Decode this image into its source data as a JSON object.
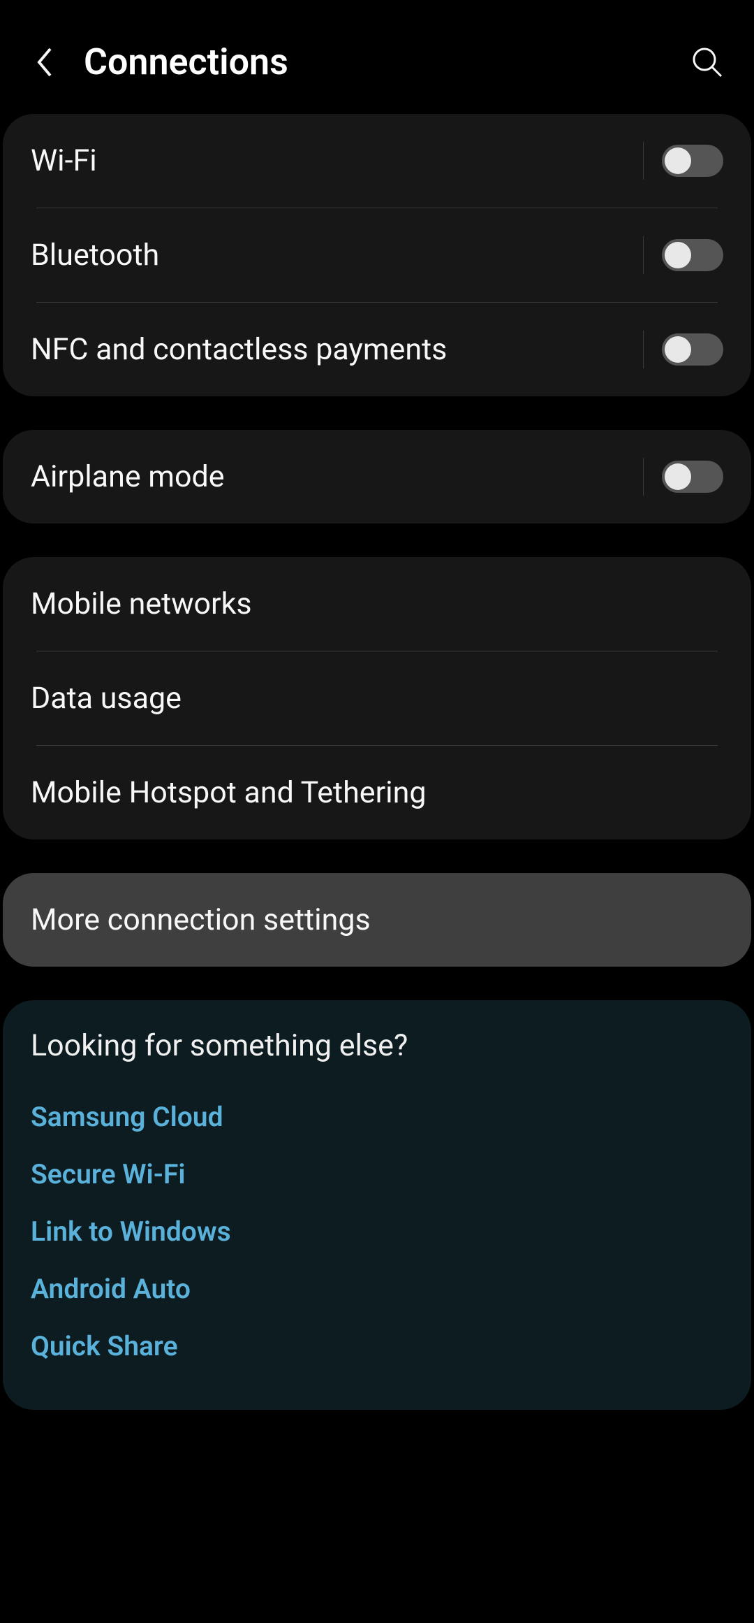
{
  "header": {
    "title": "Connections"
  },
  "group1": {
    "items": [
      {
        "label": "Wi-Fi",
        "toggle": false
      },
      {
        "label": "Bluetooth",
        "toggle": false
      },
      {
        "label": "NFC and contactless payments",
        "toggle": false
      }
    ]
  },
  "group2": {
    "items": [
      {
        "label": "Airplane mode",
        "toggle": false
      }
    ]
  },
  "group3": {
    "items": [
      {
        "label": "Mobile networks"
      },
      {
        "label": "Data usage"
      },
      {
        "label": "Mobile Hotspot and Tethering"
      }
    ]
  },
  "group4": {
    "items": [
      {
        "label": "More connection settings"
      }
    ]
  },
  "looking": {
    "title": "Looking for something else?",
    "links": [
      {
        "label": "Samsung Cloud"
      },
      {
        "label": "Secure Wi-Fi"
      },
      {
        "label": "Link to Windows"
      },
      {
        "label": "Android Auto"
      },
      {
        "label": "Quick Share"
      }
    ]
  }
}
